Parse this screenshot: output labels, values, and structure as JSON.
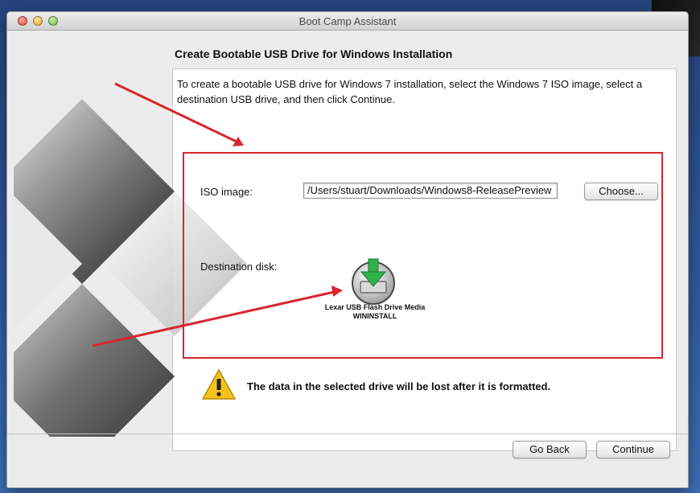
{
  "window": {
    "title": "Boot Camp Assistant"
  },
  "page": {
    "heading": "Create Bootable USB Drive for Windows Installation",
    "instructions": "To create a bootable USB drive for Windows 7 installation, select the Windows 7 ISO image, select a destination USB drive, and then click Continue."
  },
  "iso": {
    "label": "ISO image:",
    "value": "/Users/stuart/Downloads/Windows8-ReleasePreview",
    "choose_label": "Choose..."
  },
  "destination": {
    "label": "Destination disk:",
    "disk_name_line1": "Lexar USB Flash Drive Media",
    "disk_name_line2": "WININSTALL"
  },
  "warning": {
    "text": "The data in the selected drive will be lost after it is formatted."
  },
  "footer": {
    "go_back_label": "Go Back",
    "continue_label": "Continue"
  },
  "colors": {
    "highlight": "#d7272f",
    "arrow": "#d7272f",
    "warning_yellow": "#f4c21c",
    "disk_arrow_green": "#2eb34a"
  },
  "icons": {
    "close": "close-icon",
    "minimize": "minimize-icon",
    "zoom": "zoom-icon",
    "disk": "usb-disk-icon",
    "warning": "warning-icon",
    "graphic": "windows-logo-graphic"
  }
}
